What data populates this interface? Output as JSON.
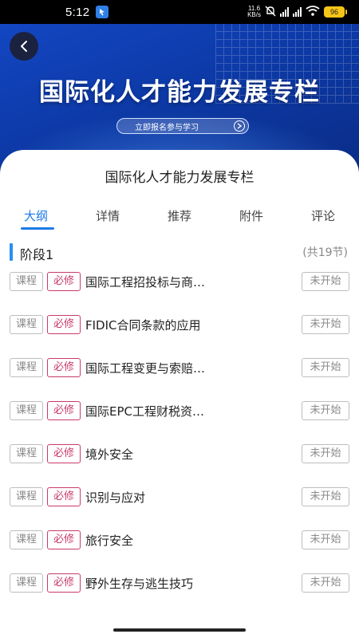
{
  "status_bar": {
    "time": "5:12",
    "net_speed_value": "11.6",
    "net_speed_unit": "KB/s",
    "battery": "96"
  },
  "banner": {
    "title": "国际化人才能力发展专栏",
    "cta": "立即报名参与学习"
  },
  "course": {
    "title": "国际化人才能力发展专栏"
  },
  "tabs": [
    {
      "label": "大纲",
      "active": true
    },
    {
      "label": "详情",
      "active": false
    },
    {
      "label": "推荐",
      "active": false
    },
    {
      "label": "附件",
      "active": false
    },
    {
      "label": "评论",
      "active": false
    }
  ],
  "stage": {
    "title": "阶段1",
    "count": "(共19节)"
  },
  "lessons": [
    {
      "type": "课程",
      "required": "必修",
      "name": "国际工程招投标与商…",
      "status": "未开始"
    },
    {
      "type": "课程",
      "required": "必修",
      "name": "FIDIC合同条款的应用",
      "status": "未开始"
    },
    {
      "type": "课程",
      "required": "必修",
      "name": "国际工程变更与索赔…",
      "status": "未开始"
    },
    {
      "type": "课程",
      "required": "必修",
      "name": "国际EPC工程财税资…",
      "status": "未开始"
    },
    {
      "type": "课程",
      "required": "必修",
      "name": "境外安全",
      "status": "未开始"
    },
    {
      "type": "课程",
      "required": "必修",
      "name": "识别与应对",
      "status": "未开始"
    },
    {
      "type": "课程",
      "required": "必修",
      "name": "旅行安全",
      "status": "未开始"
    },
    {
      "type": "课程",
      "required": "必修",
      "name": "野外生存与逃生技巧",
      "status": "未开始"
    }
  ],
  "colors": {
    "accent": "#1b7ae8",
    "required": "#c93a6b",
    "banner": "#0d3aa8"
  }
}
